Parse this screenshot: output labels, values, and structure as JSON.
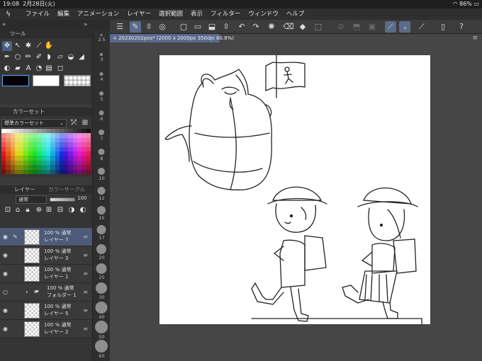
{
  "status_bar": {
    "time": "19:08",
    "date": "2月28日(火)",
    "battery": "86%"
  },
  "menu": {
    "items": [
      "ファイル",
      "編集",
      "アニメーション",
      "レイヤー",
      "選択範囲",
      "表示",
      "フィルター",
      "ウィンドウ",
      "ヘルプ"
    ]
  },
  "tool_palette": {
    "title": "ツール"
  },
  "color_set": {
    "title": "カラーセット",
    "set_name": "標準カラーセット"
  },
  "layer_panel": {
    "tab_layer": "レイヤー",
    "tab_other": "カラーサークル",
    "blend_mode": "通常",
    "opacity": "100",
    "layers": [
      {
        "opacity_mode": "100 % 通常",
        "name": "レイヤー 7",
        "active": true
      },
      {
        "opacity_mode": "100 % 通常",
        "name": "レイヤー 3",
        "active": false
      },
      {
        "opacity_mode": "100 % 通常",
        "name": "レイヤー 1",
        "active": false
      },
      {
        "opacity_mode": "100 % 通常",
        "name": "フォルダー 1",
        "active": false,
        "folder": true
      },
      {
        "opacity_mode": "100 % 通常",
        "name": "レイヤー 5",
        "active": false
      },
      {
        "opacity_mode": "100 % 通常",
        "name": "レイヤー 2",
        "active": false
      }
    ]
  },
  "brush_sizes": [
    "2.5",
    "3",
    "4",
    "5",
    "6",
    "7",
    "8",
    "10",
    "12",
    "15",
    "17",
    "20",
    "25",
    "30",
    "40",
    "50",
    "60"
  ],
  "document_tab": "20230202pos* (2000 x 2000px 350dpi 60.8%)",
  "colors": {
    "accent": "#5b6b8a",
    "active_layer": "#4d5a78"
  }
}
